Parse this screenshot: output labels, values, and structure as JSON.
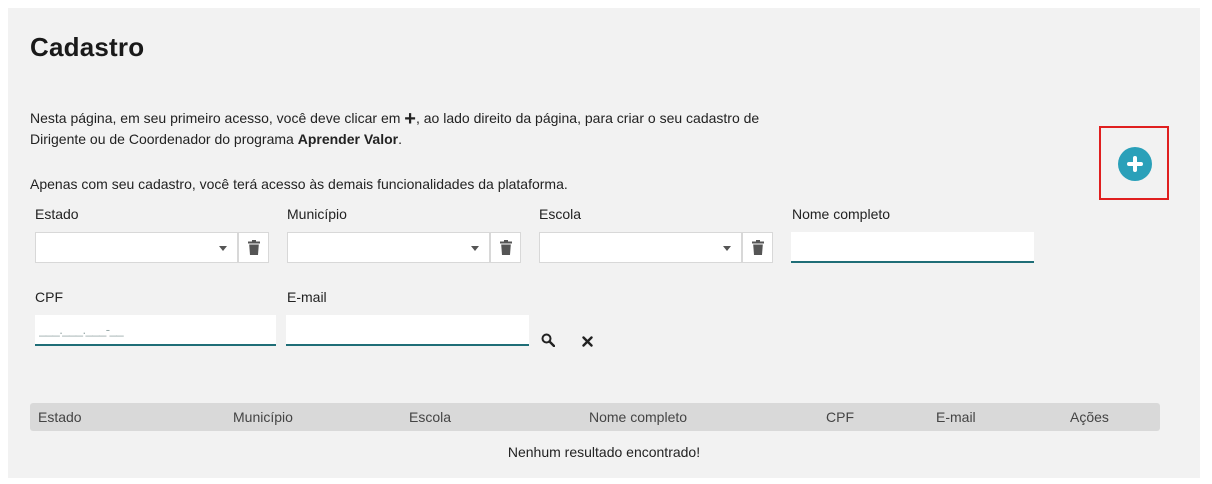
{
  "page": {
    "title": "Cadastro",
    "intro_part1": "Nesta página, em seu primeiro acesso, você deve clicar em ",
    "intro_plus": "+",
    "intro_part2": ", ao lado direito da página, para criar o seu cadastro de Dirigente ou de Coordenador do programa ",
    "intro_program": "Aprender Valor",
    "intro_part3": ".",
    "intro_second": "Apenas com seu cadastro, você terá acesso às demais funcionalidades da plataforma."
  },
  "filters": {
    "estado_label": "Estado",
    "municipio_label": "Município",
    "escola_label": "Escola",
    "nome_label": "Nome completo",
    "cpf_label": "CPF",
    "cpf_placeholder": "___.___.___-__",
    "email_label": "E-mail",
    "search_icon": "search-icon",
    "clear_icon": "close-icon",
    "trash_icon": "trash-icon"
  },
  "add_button": {
    "icon": "plus-circle-icon",
    "color": "#2aa0b9",
    "highlight_color": "#e01f1f"
  },
  "table": {
    "columns": [
      "Estado",
      "Município",
      "Escola",
      "Nome completo",
      "CPF",
      "E-mail",
      "Ações"
    ],
    "empty_message": "Nenhum resultado encontrado!"
  }
}
